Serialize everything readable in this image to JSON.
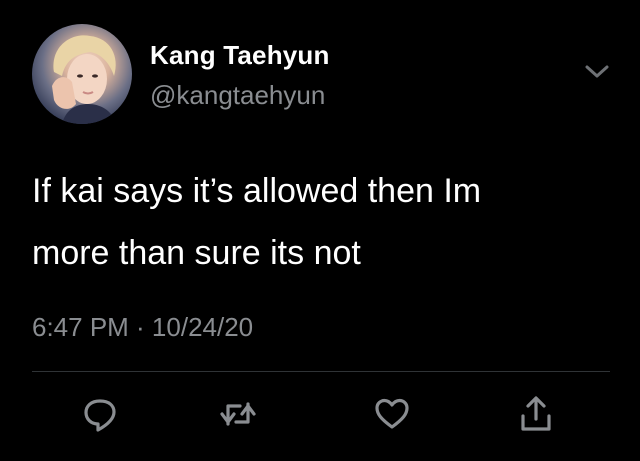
{
  "author": {
    "name": "Kang Taehyun",
    "handle": "@kangtaehyun"
  },
  "tweet": {
    "line1": "If kai says it’s allowed then Im",
    "line2": "more than sure its not",
    "timestamp": "6:47 PM · 10/24/20"
  },
  "icons": {
    "avatar": "profile-photo",
    "menu": "chevron-down-icon",
    "reply": "reply-icon",
    "retweet": "retweet-icon",
    "like": "heart-icon",
    "share": "share-icon"
  },
  "colors": {
    "background": "#000000",
    "primary_text": "#ffffff",
    "secondary_text": "#8a8d91",
    "divider": "#2f3336"
  }
}
